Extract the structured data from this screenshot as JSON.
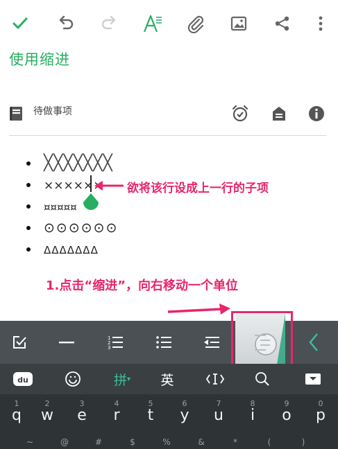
{
  "title": "使用缩进",
  "notebook": {
    "label": "待做事项"
  },
  "toolbar_icons": [
    "check-icon",
    "undo-icon",
    "redo-icon",
    "text-format-icon",
    "attachment-icon",
    "image-icon",
    "share-icon",
    "more-icon"
  ],
  "list_items": [
    "╳╳╳╳╳╳╳",
    "××××××",
    "¤¤¤¤¤",
    "⊙⊙⊙⊙⊙⊙",
    "ΔΔΔΔΔΔΔ"
  ],
  "annotations": {
    "row_hint": "欲将该行设成上一行的子项",
    "step1": "1.点击“缩进”，向右移动一个单位"
  },
  "keyboard": {
    "top_bar": [
      "拼",
      "英"
    ],
    "row1": [
      {
        "hint": "1",
        "char": "q"
      },
      {
        "hint": "2",
        "char": "w"
      },
      {
        "hint": "3",
        "char": "e"
      },
      {
        "hint": "4",
        "char": "r"
      },
      {
        "hint": "5",
        "char": "t"
      },
      {
        "hint": "6",
        "char": "y"
      },
      {
        "hint": "7",
        "char": "u"
      },
      {
        "hint": "8",
        "char": "i"
      },
      {
        "hint": "9",
        "char": "o"
      },
      {
        "hint": "0",
        "char": "p"
      }
    ],
    "row2_hints": [
      "~",
      "@",
      "#",
      "$",
      "%",
      "&",
      "*",
      "(",
      ")"
    ]
  },
  "colors": {
    "accent": "#27ae60",
    "annotation": "#e8266c",
    "format_bar": "#4b5055",
    "keyboard": "#2e3436"
  }
}
